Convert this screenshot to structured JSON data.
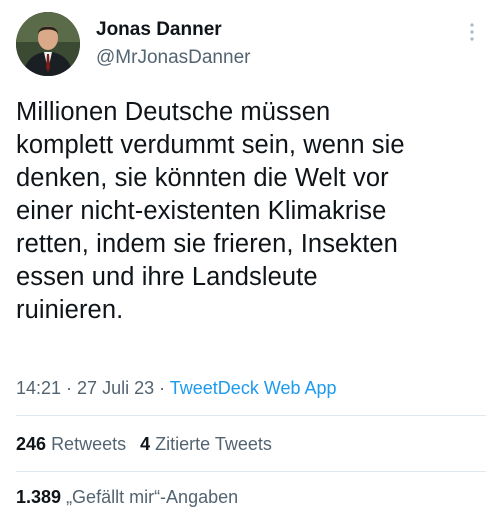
{
  "user": {
    "display_name": "Jonas Danner",
    "handle": "@MrJonasDanner"
  },
  "tweet": {
    "text_lines": [
      "Millionen Deutsche müssen",
      "komplett verdummt sein, wenn sie",
      "denken, sie könnten die Welt vor",
      "einer nicht-existenten Klimakrise",
      "retten, indem sie frieren, Insekten",
      "essen und ihre Landsleute",
      "ruinieren."
    ],
    "time": "14:21",
    "separator": " · ",
    "date": "27 Juli 23",
    "source": "TweetDeck Web App"
  },
  "stats": {
    "retweets_count": "246",
    "retweets_label": "Retweets",
    "quotes_count": "4",
    "quotes_label": "Zitierte Tweets",
    "likes_count": "1.389",
    "likes_label": "„Gefällt mir“-Angaben"
  },
  "icons": {
    "more": "more-vertical-icon"
  },
  "colors": {
    "text": "#0f1419",
    "secondary": "#536471",
    "link": "#1d9bf0",
    "divider": "#e1e8ed"
  }
}
